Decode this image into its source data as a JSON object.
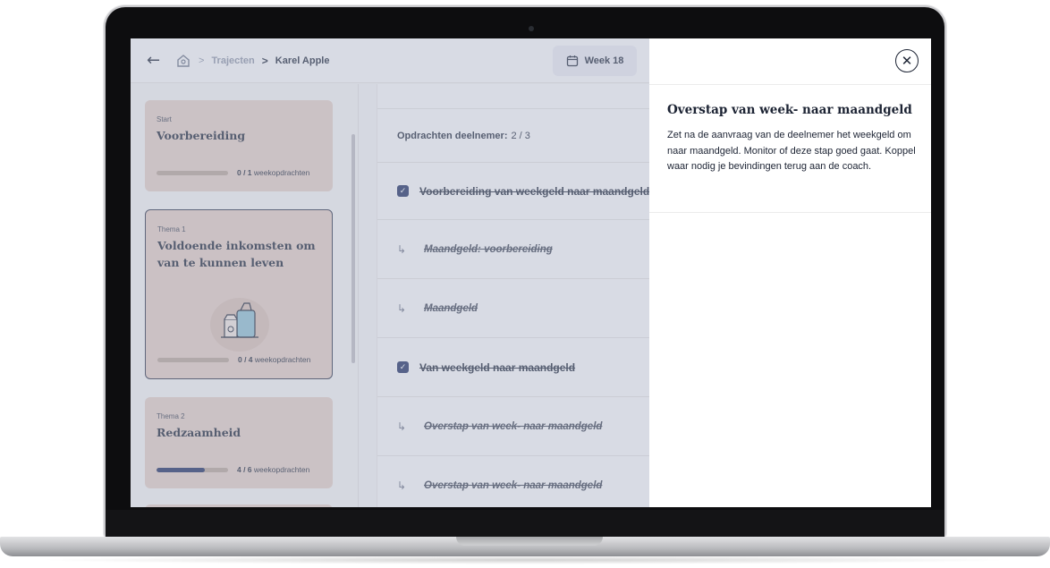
{
  "topbar": {
    "breadcrumb": [
      "Trajecten",
      "Karel Apple"
    ],
    "week_label": "Week 18"
  },
  "sidebar": {
    "cards": [
      {
        "kicker": "Start",
        "title": "Voorbereiding",
        "progress_count": "0 / 1",
        "progress_unit": "weekopdrachten",
        "progress_fraction": 0.0
      },
      {
        "kicker": "Thema 1",
        "title": "Voldoende inkomsten om van te kunnen leven",
        "progress_count": "0 / 4",
        "progress_unit": "weekopdrachten",
        "progress_fraction": 0.0
      },
      {
        "kicker": "Thema 2",
        "title": "Redzaamheid",
        "progress_count": "4 / 6",
        "progress_unit": "weekopdrachten",
        "progress_fraction": 0.67
      }
    ]
  },
  "content": {
    "assignments_label": "Opdrachten deelnemer:",
    "assignments_value": "2 / 3",
    "tasks": [
      {
        "kind": "task",
        "text": "Voorbereiding van weekgeld naar maandgeld"
      },
      {
        "kind": "sub",
        "text": "Maandgeld: voorbereiding"
      },
      {
        "kind": "sub",
        "text": "Maandgeld"
      },
      {
        "kind": "task",
        "text": "Van weekgeld naar maandgeld"
      },
      {
        "kind": "sub",
        "text": "Overstap van week- naar maandgeld"
      },
      {
        "kind": "sub",
        "text": "Overstap van week- naar maandgeld"
      }
    ]
  },
  "panel": {
    "title": "Overstap van week- naar maandgeld",
    "body": "Zet na de aanvraag van de deelnemer het weekgeld om naar maandgeld. Monitor of deze stap goed gaat. Koppel waar nodig je bevindingen terug aan de coach."
  },
  "colors": {
    "accent": "#1c2a5c",
    "card_bg": "#e6cfc3",
    "overlay": "#a6b0c8"
  }
}
